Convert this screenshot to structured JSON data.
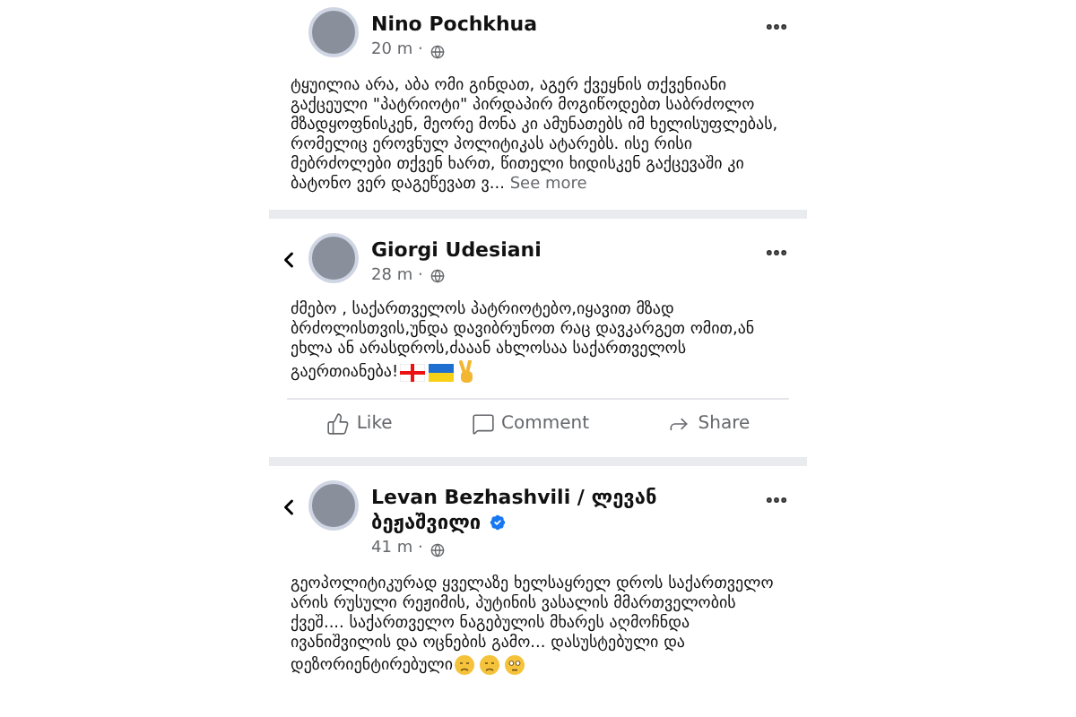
{
  "posts": [
    {
      "author": "Nino Pochkhua",
      "time": "20 m ·",
      "back": false,
      "verified": false,
      "text": "ტყუილია არა, აბა ომი გინდათ, აგერ ქვეყნის თქვენიანი გაქცეული \"პატრიოტი\" პირდაპირ მოგიწოდებთ საბრძოლო მზადყოფნისკენ, მეორე მონა კი ამუნათებს იმ ხელისუფლებას, რომელიც ეროვნულ პოლიტიკას ატარებს. ისე რისი მებრძოლები თქვენ ხართ, წითელი ხიდისკენ გაქცევაში კი ბატონო ვერ დაგეწევათ ვ...",
      "see_more": "See more"
    },
    {
      "author": "Giorgi Udesiani",
      "time": "28 m ·",
      "back": true,
      "verified": false,
      "text": "ძმებო , საქართველოს პატრიოტებო,იყავით მზად ბრძოლისთვის,უნდა დავიბრუნოთ რაც დავკარგეთ ომით,ან ეხლა ან არასდროს,ძააან ახლოსაა საქართველოს გაერთიანება!",
      "actions": [
        {
          "kind": "like",
          "label": "Like"
        },
        {
          "kind": "comment",
          "label": "Comment"
        },
        {
          "kind": "share",
          "label": "Share"
        }
      ],
      "emojis": [
        {
          "kind": "georgia-flag"
        },
        {
          "kind": "ukraine-flag"
        },
        {
          "kind": "victory-hand"
        }
      ]
    },
    {
      "author": "Levan Bezhashvili / ლევან ბეჟაშვილი",
      "time": "41 m ·",
      "back": true,
      "verified": true,
      "text": "გეოპოლიტიკურად ყველაზე ხელსაყრელ დროს საქართველო არის რუსული რეჟიმის, პუტინის ვასალის მმართველობის ქვეშ.... საქართველო ნაგებულის მხარეს აღმოჩნდა ივანიშვილის და ოცნების გამო... დასუსტებული და დეზორიენტირებული",
      "emojis": [
        {
          "kind": "sad-face"
        },
        {
          "kind": "sad-face"
        },
        {
          "kind": "flushed-face"
        }
      ]
    }
  ]
}
